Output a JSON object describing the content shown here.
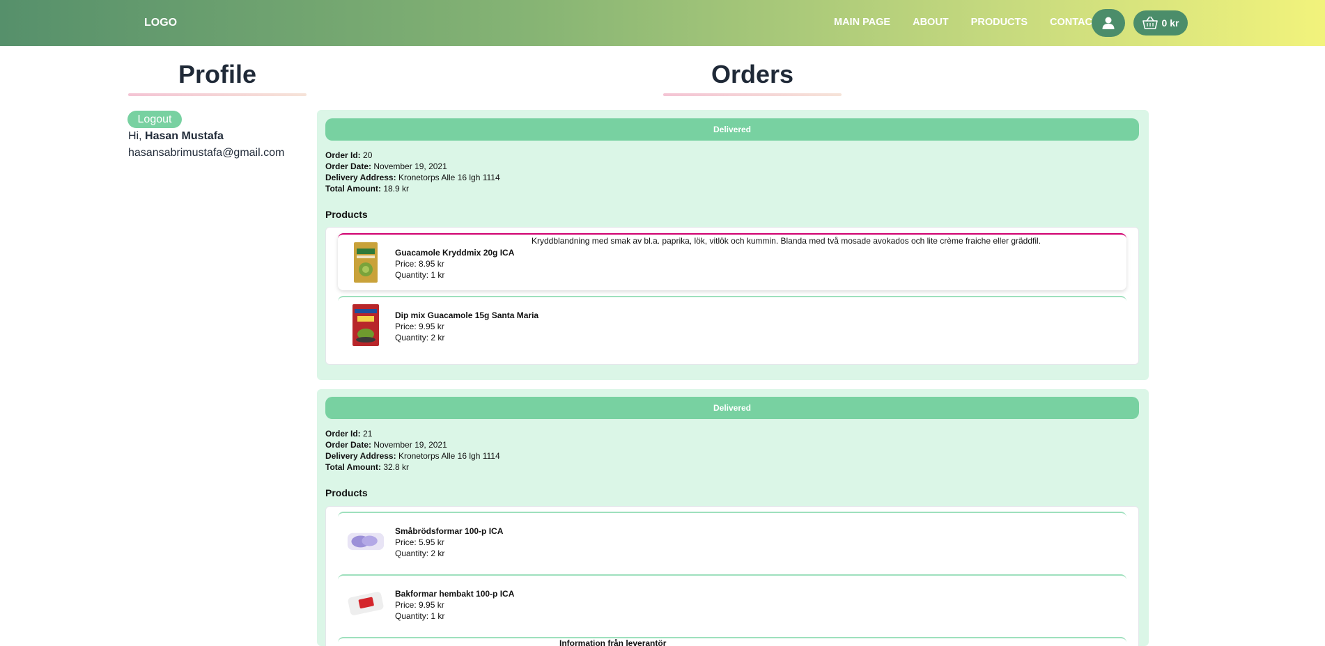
{
  "nav": {
    "logo": "LOGO",
    "links": [
      "MAIN PAGE",
      "ABOUT",
      "PRODUCTS",
      "CONTACT"
    ],
    "cart_total": "0 kr"
  },
  "profile": {
    "title": "Profile",
    "logout_label": "Logout",
    "greeting": "Hi,",
    "name": "Hasan Mustafa",
    "email": "hasansabrimustafa@gmail.com"
  },
  "orders": {
    "title": "Orders",
    "labels": {
      "order_id": "Order Id:",
      "order_date": "Order Date:",
      "delivery_address": "Delivery Address:",
      "total_amount": "Total Amount:",
      "products": "Products"
    },
    "list": [
      {
        "status": "Delivered",
        "id": "20",
        "date": "November 19, 2021",
        "address": "Kronetorps Alle 16 lgh 1114",
        "total": "18.9 kr",
        "products": [
          {
            "name": "Guacamole Kryddmix 20g ICA",
            "price": "Price: 8.95 kr",
            "quantity": "Quantity: 1 kr",
            "description": "Kryddblandning med smak av bl.a. paprika, lök, vitlök och kummin. Blanda med två mosade avokados och lite crème fraiche eller gräddfil."
          },
          {
            "name": "Dip mix Guacamole 15g Santa Maria",
            "price": "Price: 9.95 kr",
            "quantity": "Quantity: 2 kr"
          }
        ]
      },
      {
        "status": "Delivered",
        "id": "21",
        "date": "November 19, 2021",
        "address": "Kronetorps Alle 16 lgh 1114",
        "total": "32.8 kr",
        "products": [
          {
            "name": "Småbrödsformar 100-p ICA",
            "price": "Price: 5.95 kr",
            "quantity": "Quantity: 2 kr"
          },
          {
            "name": "Bakformar hembakt 100-p ICA",
            "price": "Price: 9.95 kr",
            "quantity": "Quantity: 1 kr"
          },
          {
            "description_partial": "Information från leverantör"
          }
        ]
      }
    ]
  }
}
